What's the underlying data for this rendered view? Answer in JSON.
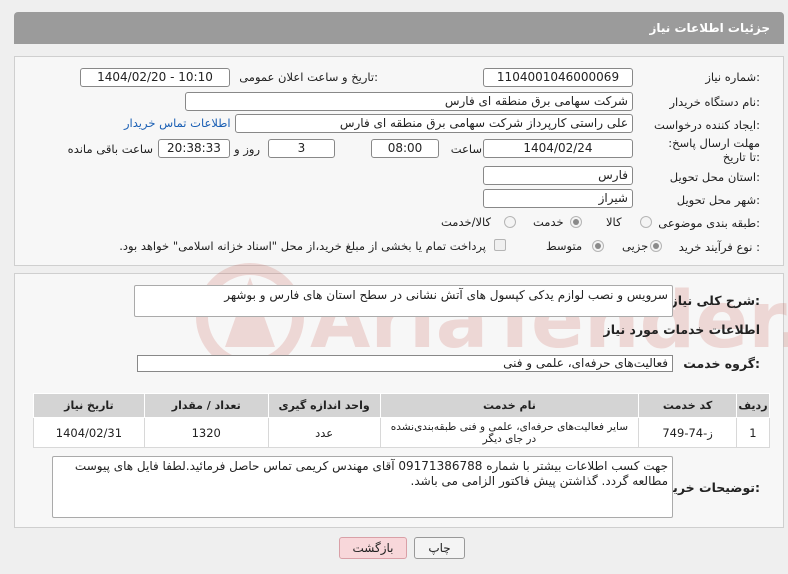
{
  "page": {
    "title": "جزئیات اطلاعات نیاز"
  },
  "labels": {
    "need_number": "شماره نیاز:",
    "announce_datetime": "تاریخ و ساعت اعلان عمومی:",
    "buyer_org": "نام دستگاه خریدار:",
    "requester": "ایجاد کننده درخواست:",
    "deadline": "مهلت ارسال پاسخ: تا تاریخ:",
    "hour": "ساعت",
    "day_and": "روز و",
    "hours_left": "ساعت باقی مانده",
    "delivery_province": "استان محل تحویل:",
    "delivery_city": "شهر محل تحویل:",
    "category": "طبقه بندی موضوعی:",
    "process_type": "نوع فرآیند خرید :",
    "description": "شرح کلی نیاز:",
    "services_info": "اطلاعات خدمات مورد نیاز",
    "service_group": "گروه خدمت:",
    "buyer_notes": "توضیحات خریدار:"
  },
  "fields": {
    "need_number": "1104001046000069",
    "announce_datetime": "1404/02/20 - 10:10",
    "buyer_org": "شرکت سهامی برق منطقه ای فارس",
    "requester": "علی راستی کارپرداز شرکت سهامی برق منطقه ای فارس",
    "contact_link": "اطلاعات تماس خریدار",
    "deadline_date": "1404/02/24",
    "deadline_time": "08:00",
    "days_left": "3",
    "time_left": "20:38:33",
    "province": "فارس",
    "city": "شیراز",
    "description": "سرویس و نصب لوازم یدکی کپسول های آتش نشانی در سطح استان های فارس و بوشهر",
    "service_group": "فعالیت‌های حرفه‌ای، علمی و فنی",
    "buyer_notes": "جهت کسب اطلاعات بیشتر با شماره 09171386788 آقای مهندس کریمی تماس حاصل فرمائید.لطفا فایل های پیوست مطالعه گردد. گذاشتن پیش فاکتور الزامی می باشد."
  },
  "category_options": [
    {
      "label": "کالا",
      "selected": false
    },
    {
      "label": "خدمت",
      "selected": true
    },
    {
      "label": "کالا/خدمت",
      "selected": false
    }
  ],
  "process_options": [
    {
      "label": "جزیی",
      "selected": true
    },
    {
      "label": "متوسط",
      "selected": true
    }
  ],
  "payment_note": "پرداخت تمام یا بخشی از مبلغ خرید،از محل \"اسناد خزانه اسلامی\" خواهد بود.",
  "table": {
    "headers": [
      "ردیف",
      "کد خدمت",
      "نام خدمت",
      "واحد اندازه گیری",
      "تعداد / مقدار",
      "تاریخ نیاز"
    ],
    "rows": [
      [
        "1",
        "ز-74-749",
        "سایر فعالیت‌های حرفه‌ای، علمی و فنی طبقه‌بندی‌نشده در جای دیگر",
        "عدد",
        "1320",
        "1404/02/31"
      ]
    ]
  },
  "buttons": {
    "print": "چاپ",
    "back": "بازگشت"
  },
  "watermark": "AriaTender.neT",
  "colors": {
    "header": "#9b9b9b",
    "link": "#1a5fb4",
    "back_button": "#f8d7da"
  }
}
